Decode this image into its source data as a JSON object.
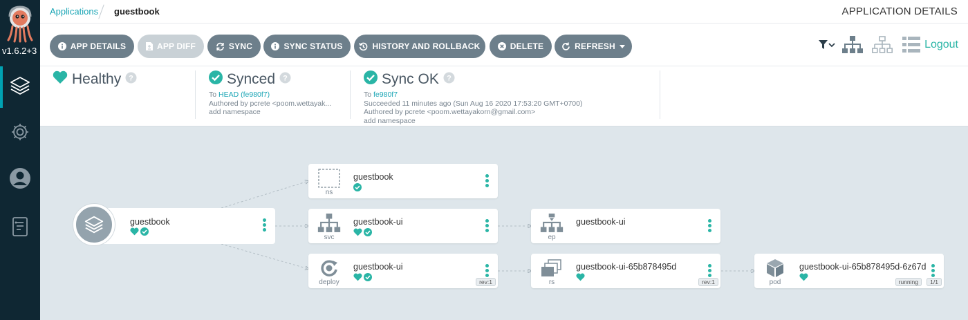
{
  "sidebar": {
    "version": "v1.6.2+3",
    "items": [
      {
        "icon": "layers-icon",
        "active": true
      },
      {
        "icon": "gear-icon",
        "active": false
      },
      {
        "icon": "user-icon",
        "active": false
      },
      {
        "icon": "docs-icon",
        "active": false
      }
    ]
  },
  "header": {
    "breadcrumb_root": "Applications",
    "breadcrumb_current": "guestbook",
    "page_title": "APPLICATION DETAILS"
  },
  "toolbar": {
    "app_details": "APP DETAILS",
    "app_diff": "APP DIFF",
    "sync": "SYNC",
    "sync_status": "SYNC STATUS",
    "history": "HISTORY AND ROLLBACK",
    "delete": "DELETE",
    "refresh": "REFRESH",
    "logout": "Logout"
  },
  "status": {
    "health": {
      "label": "Healthy"
    },
    "sync": {
      "label": "Synced",
      "to_prefix": "To",
      "to_ref": "HEAD (fe980f7)",
      "author": "Authored by pcrete <poom.wettayak...",
      "message": "add namespace"
    },
    "operation": {
      "label": "Sync OK",
      "to_prefix": "To",
      "to_ref": "fe980f7",
      "succeeded": "Succeeded 11 minutes ago (Sun Aug 16 2020 17:53:20 GMT+0700)",
      "author": "Authored by pcrete <poom.wettayakorn@gmail.com>",
      "message": "add namespace"
    }
  },
  "graph": {
    "root": {
      "name": "guestbook"
    },
    "nodes": [
      {
        "kind": "ns",
        "name": "guestbook"
      },
      {
        "kind": "svc",
        "name": "guestbook-ui"
      },
      {
        "kind": "deploy",
        "name": "guestbook-ui",
        "tag": "rev:1"
      },
      {
        "kind": "ep",
        "name": "guestbook-ui"
      },
      {
        "kind": "rs",
        "name": "guestbook-ui-65b878495d",
        "tag": "rev:1"
      },
      {
        "kind": "pod",
        "name": "guestbook-ui-65b878495d-6z67d",
        "tag": "running",
        "tag2": "1/1"
      }
    ]
  },
  "colors": {
    "accent": "#2ab5a6",
    "sidebar_bg": "#0f2733",
    "button_bg": "#6d7f8b",
    "canvas_bg": "#dee6eb"
  }
}
